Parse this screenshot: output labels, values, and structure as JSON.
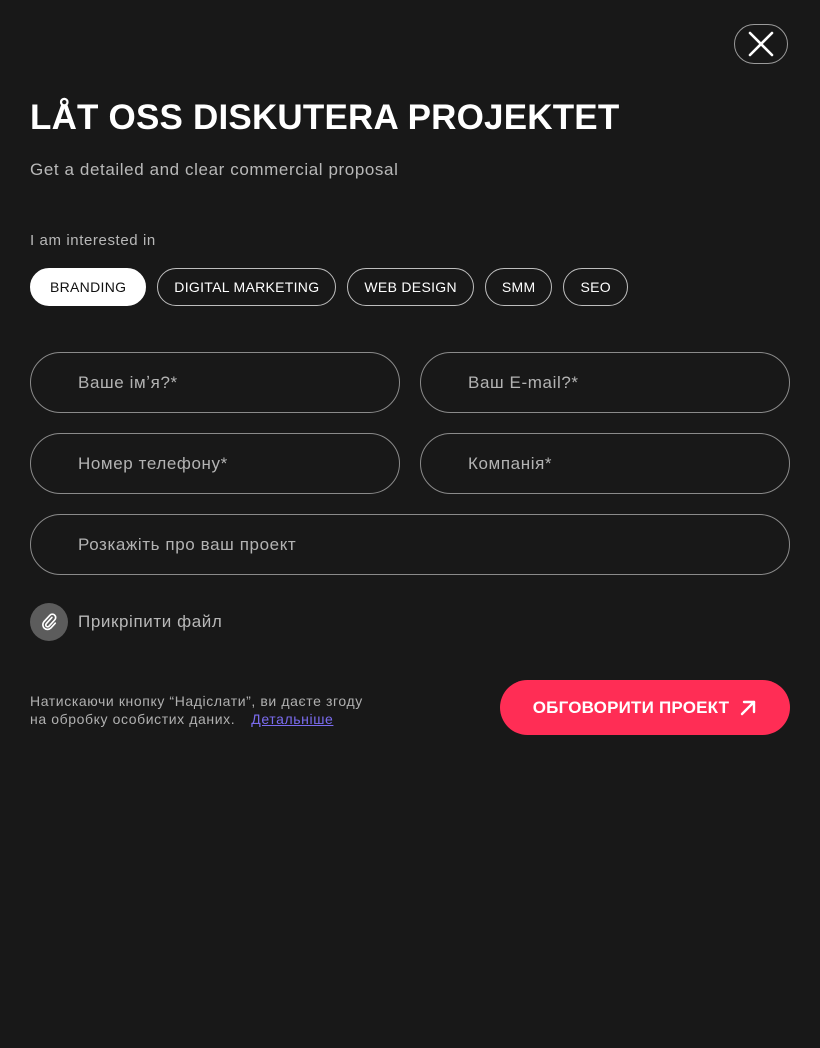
{
  "header": {
    "title": "LÅT OSS DISKUTERA PROJEKTET",
    "subtitle": "Get a detailed and clear commercial proposal"
  },
  "close": {
    "icon": "close-icon"
  },
  "interests": {
    "label": "I am interested in",
    "options": [
      {
        "label": "BRANDING",
        "selected": true
      },
      {
        "label": "DIGITAL MARKETING",
        "selected": false
      },
      {
        "label": "WEB DESIGN",
        "selected": false
      },
      {
        "label": "SMM",
        "selected": false
      },
      {
        "label": "SEO",
        "selected": false
      }
    ]
  },
  "form": {
    "name_placeholder": "Ваше імʼя?*",
    "email_placeholder": "Ваш E-mail?*",
    "phone_placeholder": "Номер телефону*",
    "company_placeholder": "Компанія*",
    "project_placeholder": "Розкажіть про ваш проект",
    "attach_label": "Прикріпити файл",
    "attach_icon": "paperclip-icon"
  },
  "consent": {
    "line1": "Натискаючи кнопку “Надіслати”, ви даєте згоду",
    "line2": "на обробку особистих даних.",
    "link": "Детальніше"
  },
  "submit": {
    "label": "ОБГОВОРИТИ ПРОЕКТ",
    "icon": "arrow-up-right-icon"
  },
  "colors": {
    "background": "#181818",
    "accent": "#ff2d55",
    "link": "#7b6cf0",
    "chip_selected_bg": "#ffffff"
  }
}
